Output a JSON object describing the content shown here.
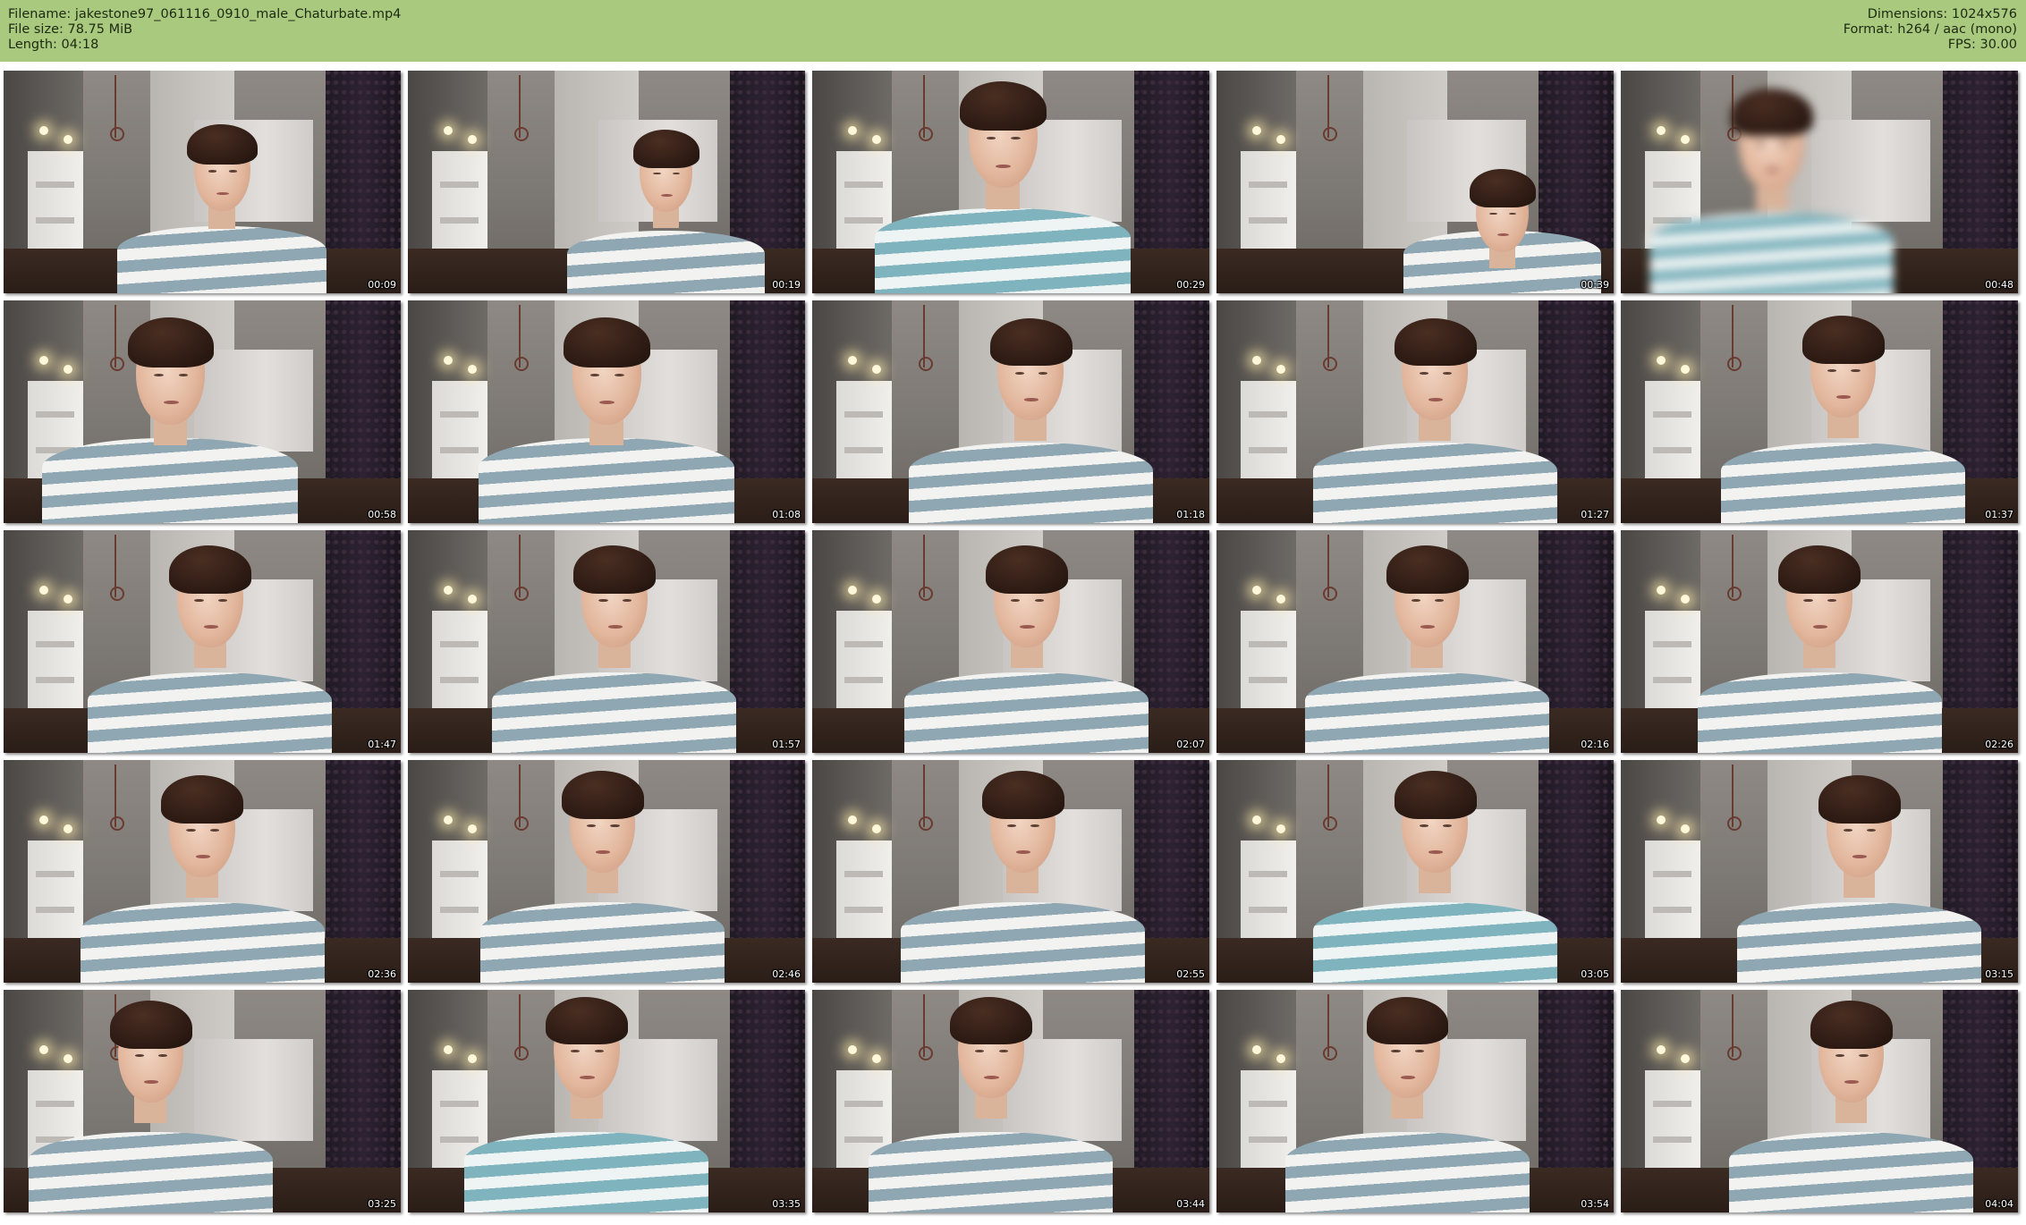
{
  "header": {
    "filename": "Filename: jakestone97_061116_0910_male_Chaturbate.mp4",
    "filesize": "File size: 78.75 MiB",
    "length": "Length: 04:18",
    "dimensions": "Dimensions: 1024x576",
    "format": "Format: h264 / aac (mono)",
    "fps": "FPS: 30.00"
  },
  "colors": {
    "header_background": "#a9c97f",
    "page_background": "#ffffff"
  },
  "thumbnails": [
    {
      "time": "00:09"
    },
    {
      "time": "00:19"
    },
    {
      "time": "00:29"
    },
    {
      "time": "00:39"
    },
    {
      "time": "00:48"
    },
    {
      "time": "00:58"
    },
    {
      "time": "01:08"
    },
    {
      "time": "01:18"
    },
    {
      "time": "01:27"
    },
    {
      "time": "01:37"
    },
    {
      "time": "01:47"
    },
    {
      "time": "01:57"
    },
    {
      "time": "02:07"
    },
    {
      "time": "02:16"
    },
    {
      "time": "02:26"
    },
    {
      "time": "02:36"
    },
    {
      "time": "02:46"
    },
    {
      "time": "02:55"
    },
    {
      "time": "03:05"
    },
    {
      "time": "03:15"
    },
    {
      "time": "03:25"
    },
    {
      "time": "03:35"
    },
    {
      "time": "03:44"
    },
    {
      "time": "03:54"
    },
    {
      "time": "04:04"
    }
  ]
}
